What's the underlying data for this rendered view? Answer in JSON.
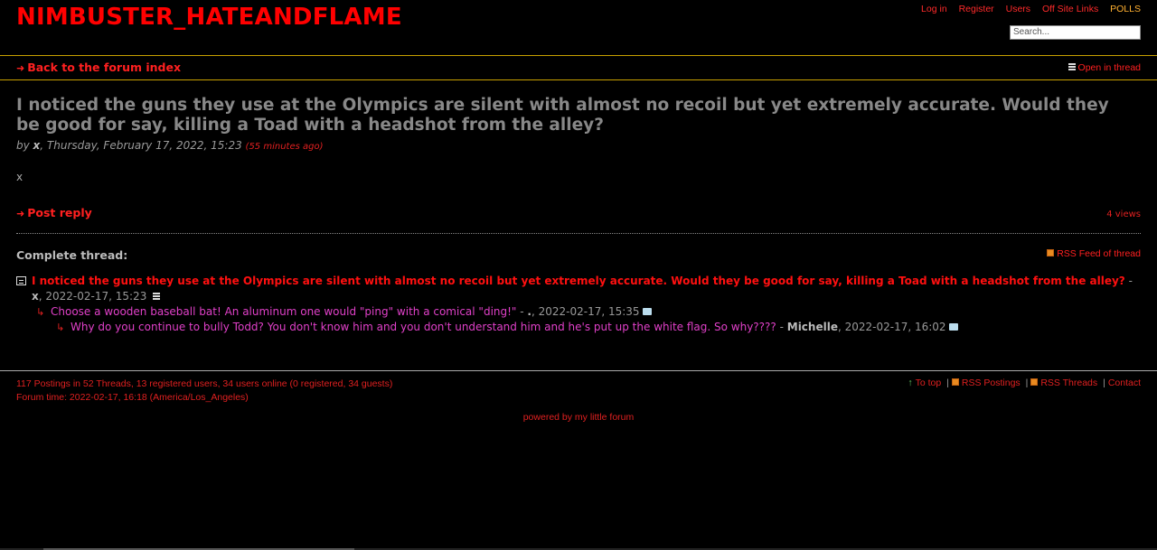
{
  "site": {
    "title": "NIMBUSTER_HATEANDFLAME"
  },
  "topnav": {
    "login": "Log in",
    "register": "Register",
    "users": "Users",
    "offsite": "Off Site Links",
    "polls": "POLLS"
  },
  "search": {
    "placeholder": "Search..."
  },
  "subnav": {
    "back": "Back to the forum index",
    "open_in_thread": "Open in thread"
  },
  "post": {
    "title": "I noticed the guns they use at the Olympics are silent with almost no recoil but yet extremely accurate. Would they be good for say, killing a Toad with a headshot from the alley?",
    "by": "by",
    "author": "x",
    "date": ", Thursday, February 17, 2022, 15:23",
    "ago": "(55 minutes ago)",
    "body": "x",
    "reply": "Post reply",
    "views": "4 views"
  },
  "thread": {
    "heading": "Complete thread:",
    "rss": "RSS Feed of thread",
    "root": {
      "title": "I noticed the guns they use at the Olympics are silent with almost no recoil but yet extremely accurate. Would they be good for say, killing a Toad with a headshot from the alley?",
      "sep": " - ",
      "author": "x",
      "date": ", 2022-02-17, 15:23"
    },
    "reply1": {
      "title": "Choose a wooden baseball bat! An aluminum one would \"ping\" with a comical \"ding!\"",
      "sep": " - ",
      "author": ".",
      "date": ", 2022-02-17, 15:35"
    },
    "reply2": {
      "title": "Why do you continue to bully Todd? You don't know him and you don't understand him and he's put up the white flag. So why????",
      "sep": " - ",
      "author": "Michelle",
      "date": ", 2022-02-17, 16:02"
    }
  },
  "footer": {
    "stats": "117 Postings in 52 Threads, 13 registered users, 34 users online (0 registered, 34 guests)",
    "forum_time": "Forum time: 2022-02-17, 16:18 (America/Los_Angeles)",
    "to_top": "To top",
    "rss_postings": "RSS Postings",
    "rss_threads": "RSS Threads",
    "contact": "Contact",
    "pipe": "|",
    "powered": "powered by my little forum"
  }
}
